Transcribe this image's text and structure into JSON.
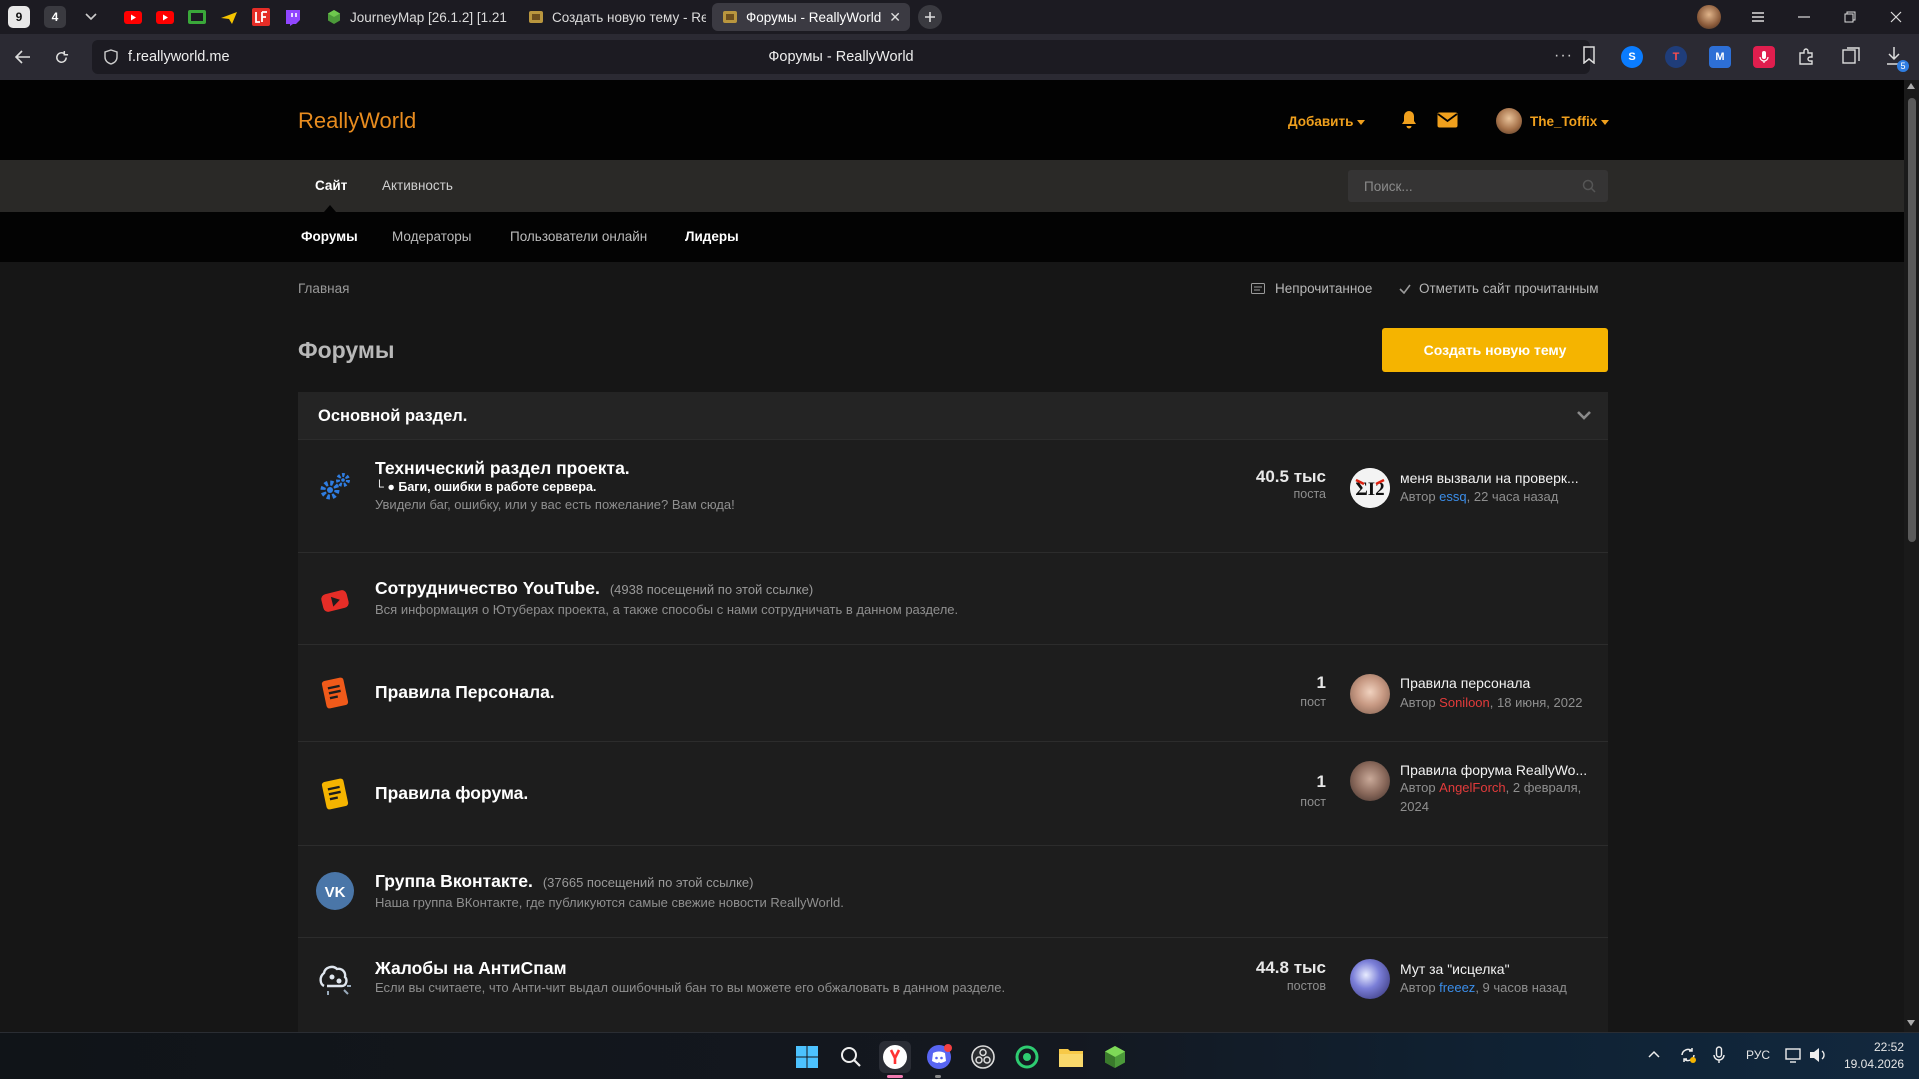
{
  "browser": {
    "tab_counter_a": "9",
    "tab_counter_b": "4",
    "tabs": [
      {
        "label": "JourneyMap [26.1.2] [1.21"
      },
      {
        "label": "Создать новую тему - Re"
      },
      {
        "label": "Форумы - ReallyWorld"
      }
    ],
    "url_host": "f.reallyworld.me",
    "url_title": "Форумы - ReallyWorld",
    "download_badge": "5"
  },
  "site": {
    "logo": "ReallyWorld",
    "add_label": "Добавить",
    "username": "The_Toffix",
    "nav_primary": [
      {
        "label": "Сайт"
      },
      {
        "label": "Активность"
      }
    ],
    "search_placeholder": "Поиск...",
    "nav_secondary": [
      {
        "label": "Форумы"
      },
      {
        "label": "Модераторы"
      },
      {
        "label": "Пользователи онлайн"
      },
      {
        "label": "Лидеры"
      }
    ],
    "breadcrumb": "Главная",
    "unread_label": "Непрочитанное",
    "mark_read_label": "Отметить сайт прочитанным",
    "page_title": "Форумы",
    "create_thread_label": "Создать новую тему"
  },
  "forum_block": {
    "title": "Основной раздел.",
    "nodes": [
      {
        "title": "Технический раздел проекта.",
        "sub": "└ ● Баги, ошибки в работе сервера.",
        "desc": "Увидели баг, ошибку, или у вас есть пожелание? Вам сюда!",
        "stat_num": "40.5 тыс",
        "stat_label": "поста",
        "last_title": "меня вызвали на проверк...",
        "last_author_prefix": "Автор ",
        "last_author": "essq",
        "last_time": ", 22 часа назад"
      },
      {
        "title": "Сотрудничество YouTube.",
        "visits": "(4938 посещений по этой ссылке)",
        "desc": "Вся информация о Ютуберах проекта, а также способы с нами сотрудничать в данном разделе."
      },
      {
        "title": "Правила Персонала.",
        "stat_num": "1",
        "stat_label": "пост",
        "last_title": "Правила персонала",
        "last_author_prefix": "Автор ",
        "last_author": "Soniloon",
        "last_time": ", 18 июня, 2022"
      },
      {
        "title": "Правила форума.",
        "stat_num": "1",
        "stat_label": "пост",
        "last_title": "Правила форума ReallyWo...",
        "last_author_prefix": "Автор ",
        "last_author": "AngelForch",
        "last_time": ", 2 февраля, 2024"
      },
      {
        "title": "Группа Вконтакте.",
        "visits": "(37665 посещений по этой ссылке)",
        "desc": "Наша группа ВКонтакте, где публикуются самые свежие новости ReallyWorld."
      },
      {
        "title": "Жалобы на АнтиСпам",
        "desc": "Если вы считаете, что Анти-чит выдал ошибочный бан то вы можете его обжаловать в данном разделе.",
        "stat_num": "44.8 тыс",
        "stat_label": "постов",
        "last_title": "Мут за \"исцелка\"",
        "last_author_prefix": "Автор ",
        "last_author": "freeez",
        "last_time": ", 9 часов назад"
      }
    ]
  },
  "taskbar": {
    "lang": "РУС",
    "time": "22:52",
    "date": "19.04.2026"
  },
  "colors": {
    "accent": "#f0a01d",
    "button": "#f5b400",
    "link_blue": "#3b8eea",
    "link_red": "#e23b3b"
  }
}
